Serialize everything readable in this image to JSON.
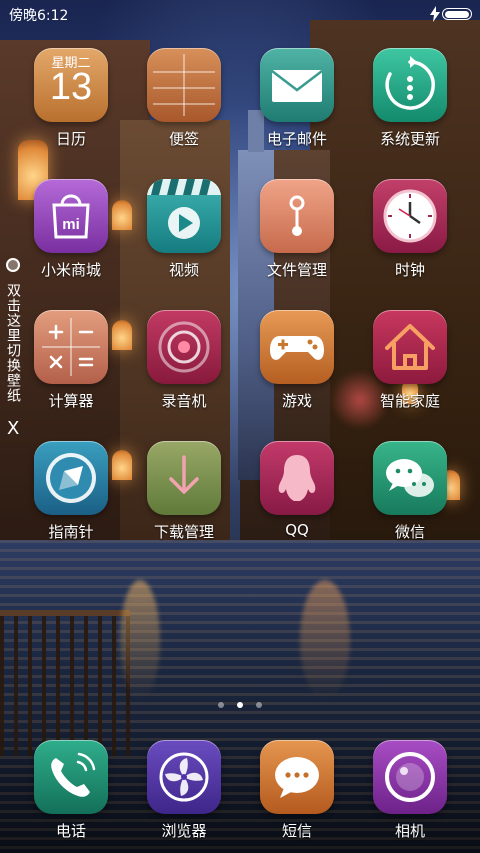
{
  "status_bar": {
    "time": "傍晚6:12",
    "charging_icon": "lightning-icon",
    "battery_icon": "battery-icon"
  },
  "wallpaper_hint": {
    "text": "双击这里切换壁纸",
    "close_glyph": "X"
  },
  "apps": [
    {
      "label": "日历",
      "icon": "calendar-icon",
      "weekday": "星期二",
      "day": "13",
      "colors": [
        "#e3a86a",
        "#b9702e"
      ]
    },
    {
      "label": "便签",
      "icon": "notes-icon",
      "colors": [
        "#d8905a",
        "#a8582b"
      ]
    },
    {
      "label": "电子邮件",
      "icon": "mail-icon",
      "colors": [
        "#4fb3a5",
        "#1f7c72"
      ]
    },
    {
      "label": "系统更新",
      "icon": "update-icon",
      "colors": [
        "#3fc7a2",
        "#138a6c"
      ]
    },
    {
      "label": "小米商城",
      "icon": "mi-store-icon",
      "colors": [
        "#b56ad8",
        "#7a2fa0"
      ]
    },
    {
      "label": "视频",
      "icon": "video-icon",
      "colors": [
        "#3fb3b1",
        "#157c80"
      ]
    },
    {
      "label": "文件管理",
      "icon": "file-manager-icon",
      "colors": [
        "#f0a488",
        "#c76a4c"
      ]
    },
    {
      "label": "时钟",
      "icon": "clock-icon",
      "colors": [
        "#c2406a",
        "#8a1a45"
      ]
    },
    {
      "label": "计算器",
      "icon": "calculator-icon",
      "colors": [
        "#e39d7e",
        "#b3604a"
      ]
    },
    {
      "label": "录音机",
      "icon": "recorder-icon",
      "colors": [
        "#c23a63",
        "#881a3c"
      ]
    },
    {
      "label": "游戏",
      "icon": "game-controller-icon",
      "colors": [
        "#e79a55",
        "#b55f22"
      ]
    },
    {
      "label": "智能家庭",
      "icon": "smart-home-icon",
      "colors": [
        "#c8375e",
        "#8d1a3e"
      ]
    },
    {
      "label": "指南针",
      "icon": "compass-icon",
      "colors": [
        "#3a9fbf",
        "#1b5f86"
      ]
    },
    {
      "label": "下载管理",
      "icon": "download-icon",
      "colors": [
        "#99a866",
        "#5f7a3a"
      ]
    },
    {
      "label": "QQ",
      "icon": "qq-penguin-icon",
      "colors": [
        "#c33a6a",
        "#871a45"
      ]
    },
    {
      "label": "微信",
      "icon": "wechat-icon",
      "colors": [
        "#38b58a",
        "#177a5c"
      ]
    }
  ],
  "page_indicator": {
    "pages": 3,
    "current": 2
  },
  "dock": [
    {
      "label": "电话",
      "icon": "phone-icon",
      "colors": [
        "#2fae8c",
        "#137058"
      ]
    },
    {
      "label": "浏览器",
      "icon": "browser-icon",
      "colors": [
        "#6a4cc0",
        "#3e2689"
      ]
    },
    {
      "label": "短信",
      "icon": "message-icon",
      "colors": [
        "#e5964f",
        "#b45a1f"
      ]
    },
    {
      "label": "相机",
      "icon": "camera-icon",
      "colors": [
        "#a84dc4",
        "#6d2289"
      ]
    }
  ]
}
